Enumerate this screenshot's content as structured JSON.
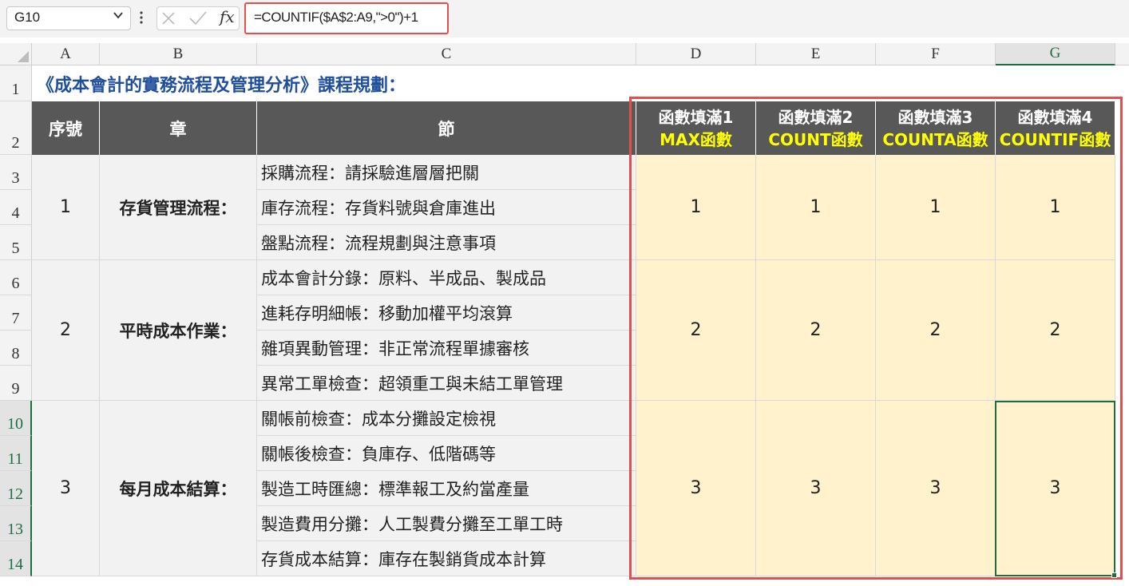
{
  "formula_bar": {
    "name_box": "G10",
    "formula": "=COUNTIF($A$2:A9,\">0\")+1",
    "fx": "fx"
  },
  "columns": [
    "A",
    "B",
    "C",
    "D",
    "E",
    "F",
    "G"
  ],
  "rows": [
    "1",
    "2",
    "3",
    "4",
    "5",
    "6",
    "7",
    "8",
    "9",
    "10",
    "11",
    "12",
    "13",
    "14"
  ],
  "selected_cell": "G10",
  "sheet": {
    "title": "《成本會計的實務流程及管理分析》課程規劃：",
    "headers": {
      "seq": "序號",
      "chapter": "章",
      "section": "節",
      "d_line1": "函數填滿1",
      "d_line2": "MAX函數",
      "e_line1": "函數填滿2",
      "e_line2": "COUNT函數",
      "f_line1": "函數填滿3",
      "f_line2": "COUNTA函數",
      "g_line1": "函數填滿4",
      "g_line2": "COUNTIF函數"
    },
    "groups": [
      {
        "seq": "1",
        "chapter": "存貨管理流程：",
        "d": "1",
        "e": "1",
        "f": "1",
        "g": "1"
      },
      {
        "seq": "2",
        "chapter": "平時成本作業：",
        "d": "2",
        "e": "2",
        "f": "2",
        "g": "2"
      },
      {
        "seq": "3",
        "chapter": "每月成本結算：",
        "d": "3",
        "e": "3",
        "f": "3",
        "g": "3"
      }
    ],
    "sections": [
      "採購流程：請採驗進層層把關",
      "庫存流程：存貨料號與倉庫進出",
      "盤點流程：流程規劃與注意事項",
      "成本會計分錄：原料、半成品、製成品",
      "進耗存明細帳：移動加權平均滾算",
      "雜項異動管理：非正常流程單據審核",
      "異常工單檢查：超領重工與未結工單管理",
      "關帳前檢查：成本分攤設定檢視",
      "關帳後檢查：負庫存、低階碼等",
      "製造工時匯總：標準報工及約當產量",
      "製造費用分攤：人工製費分攤至工單工時",
      "存貨成本結算：庫存在製銷貨成本計算"
    ]
  },
  "colors": {
    "header_bg": "#585858",
    "highlight_yellow": "#ffff00",
    "data_fill": "#fff2cc",
    "title_blue": "#1f4e9c",
    "annotation_red": "#e05050",
    "selection_green": "#1e6e40"
  }
}
